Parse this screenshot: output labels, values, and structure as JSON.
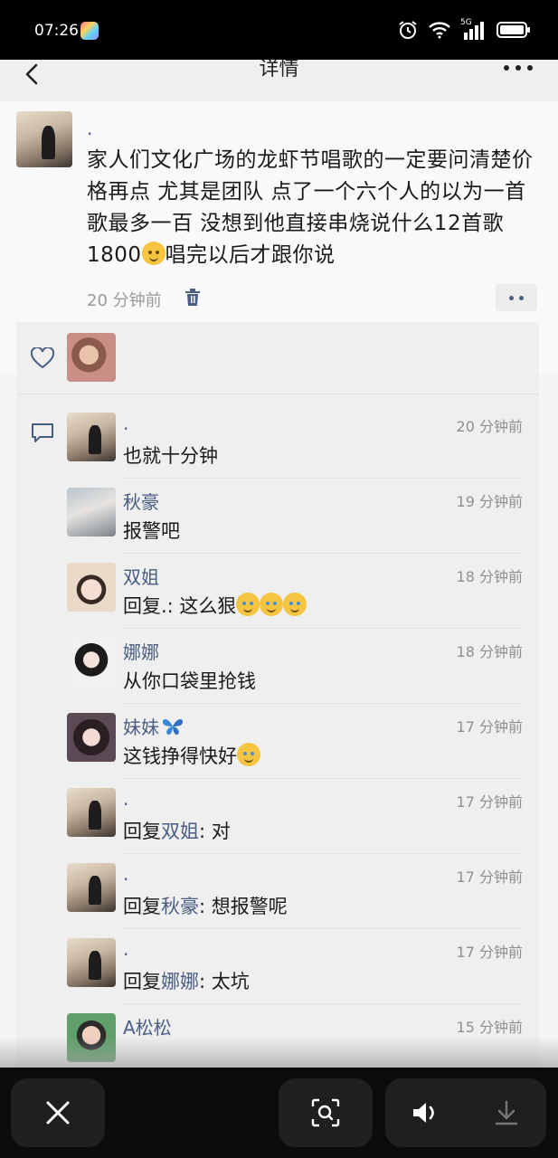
{
  "status_bar": {
    "time": "07:26",
    "network_label": "5G"
  },
  "nav": {
    "title": "详情"
  },
  "post": {
    "author": ".",
    "text_before_emoji": "家人们文化广场的龙虾节唱歌的一定要问清楚价格再点 尤其是团队 点了一个六个人的以为一首歌最多一百 没想到他直接串烧说什么12首歌 1800",
    "text_after_emoji": "唱完以后才跟你说",
    "emoji": "smile-emoji",
    "time": "20 分钟前"
  },
  "comments": [
    {
      "name": ".",
      "time": "20 分钟前",
      "text": "也就十分钟",
      "avatar": "main"
    },
    {
      "name": "秋豪",
      "time": "19 分钟前",
      "text": "报警吧",
      "avatar": "qiuhao"
    },
    {
      "name": "双姐",
      "time": "18 分钟前",
      "text": "回复.: 这么狠",
      "emoji_count": 3,
      "avatar": "shuangjie"
    },
    {
      "name": "娜娜",
      "time": "18 分钟前",
      "text": "从你口袋里抢钱",
      "avatar": "nana"
    },
    {
      "name": "妹妹",
      "time": "17 分钟前",
      "text": "这钱挣得快好",
      "emoji_count": 1,
      "avatar": "meimei",
      "name_icon": "butterfly-icon"
    },
    {
      "name": ".",
      "time": "17 分钟前",
      "reply_prefix": "回复",
      "reply_to": "双姐",
      "reply_text": ": 对",
      "avatar": "main"
    },
    {
      "name": ".",
      "time": "17 分钟前",
      "reply_prefix": "回复",
      "reply_to": "秋豪",
      "reply_text": ": 想报警呢",
      "avatar": "main"
    },
    {
      "name": ".",
      "time": "17 分钟前",
      "reply_prefix": "回复",
      "reply_to": "娜娜",
      "reply_text": ": 太坑",
      "avatar": "main"
    },
    {
      "name": "A松松",
      "time": "15 分钟前",
      "text": "",
      "avatar": "songsong"
    }
  ],
  "colors": {
    "link_name": "#4a5d82",
    "background": "#f5f5f5",
    "panel": "#efefef"
  }
}
